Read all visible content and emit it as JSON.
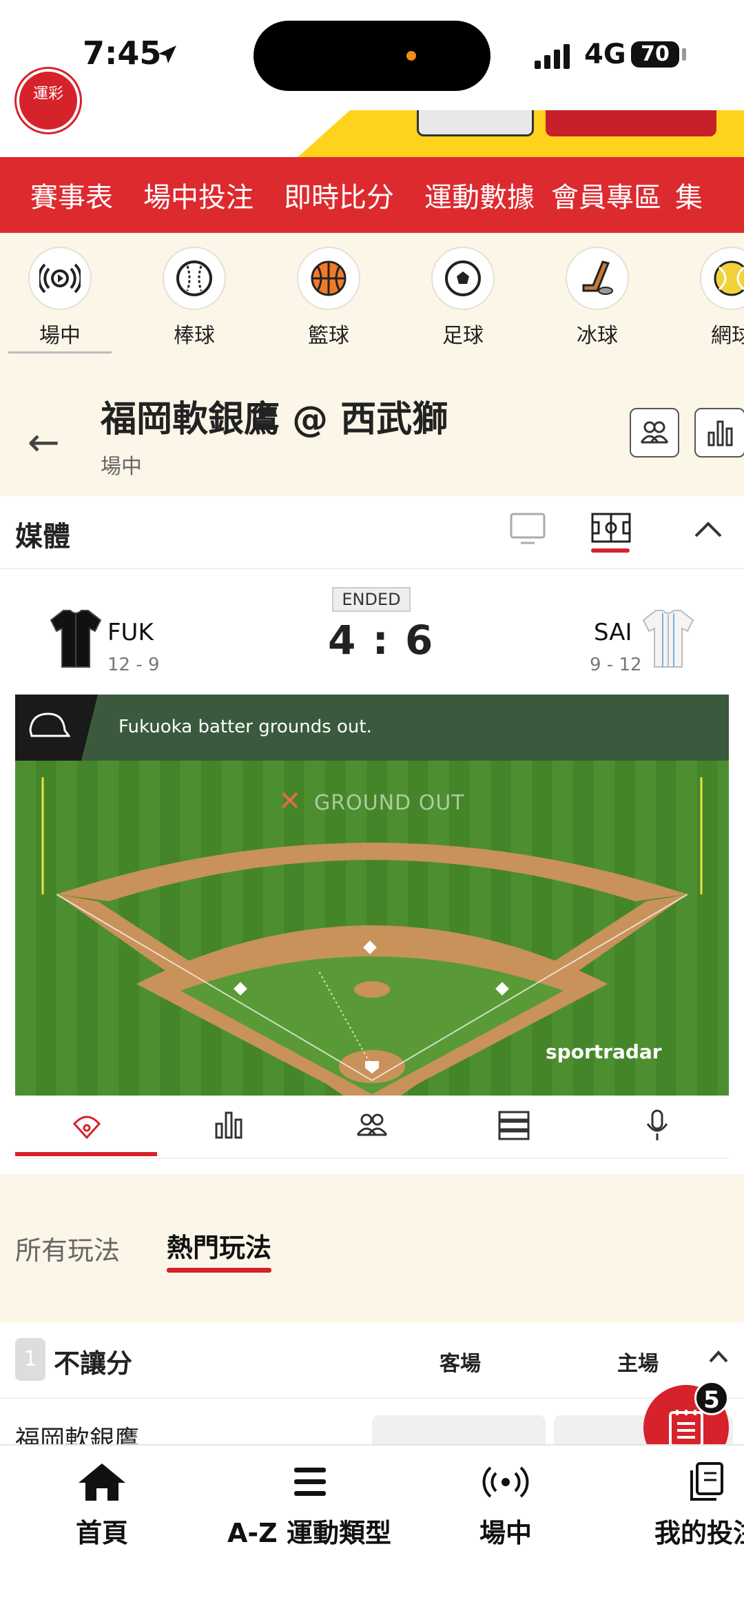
{
  "status_bar": {
    "time": "7:45",
    "network": "4G",
    "battery": "70"
  },
  "header": {
    "logo_text": "運彩"
  },
  "nav": {
    "items": [
      "賽事表",
      "場中投注",
      "即時比分",
      "運動數據",
      "會員專區",
      "集"
    ]
  },
  "sports": [
    {
      "label": "場中",
      "icon": "live-icon"
    },
    {
      "label": "棒球",
      "icon": "baseball-icon"
    },
    {
      "label": "籃球",
      "icon": "basketball-icon"
    },
    {
      "label": "足球",
      "icon": "soccer-icon"
    },
    {
      "label": "冰球",
      "icon": "hockey-icon"
    },
    {
      "label": "網球",
      "icon": "tennis-icon"
    }
  ],
  "match": {
    "title": "福岡軟銀鷹 @ 西武獅",
    "status": "場中"
  },
  "media": {
    "label": "媒體"
  },
  "scoreboard": {
    "state": "ENDED",
    "home_score": "4",
    "separator": ":",
    "away_score": "6",
    "home": {
      "abbr": "FUK",
      "record": "12 - 9"
    },
    "away": {
      "abbr": "SAI",
      "record": "9 - 12"
    }
  },
  "field": {
    "event_text": "Fukuoka batter grounds out.",
    "overlay": "GROUND OUT",
    "brand": "sportradar"
  },
  "markets": {
    "tabs": [
      "所有玩法",
      "熱門玩法"
    ],
    "active": "熱門玩法"
  },
  "odds": {
    "number": "1",
    "title": "不讓分",
    "col_away": "客場",
    "col_home": "主場",
    "rows": [
      {
        "team": "福岡軟銀鷹"
      }
    ]
  },
  "betslip": {
    "count": "5"
  },
  "bottom_nav": [
    {
      "label": "首頁",
      "icon": "home-icon"
    },
    {
      "label": "A-Z 運動類型",
      "icon": "menu-icon"
    },
    {
      "label": "場中",
      "icon": "live-icon"
    },
    {
      "label": "我的投注",
      "icon": "bets-icon"
    }
  ],
  "colors": {
    "brand_red": "#dd2a2f",
    "accent_yellow": "#ffd21e",
    "cream": "#fbf6e8",
    "field_green": "#4a8a2e"
  }
}
